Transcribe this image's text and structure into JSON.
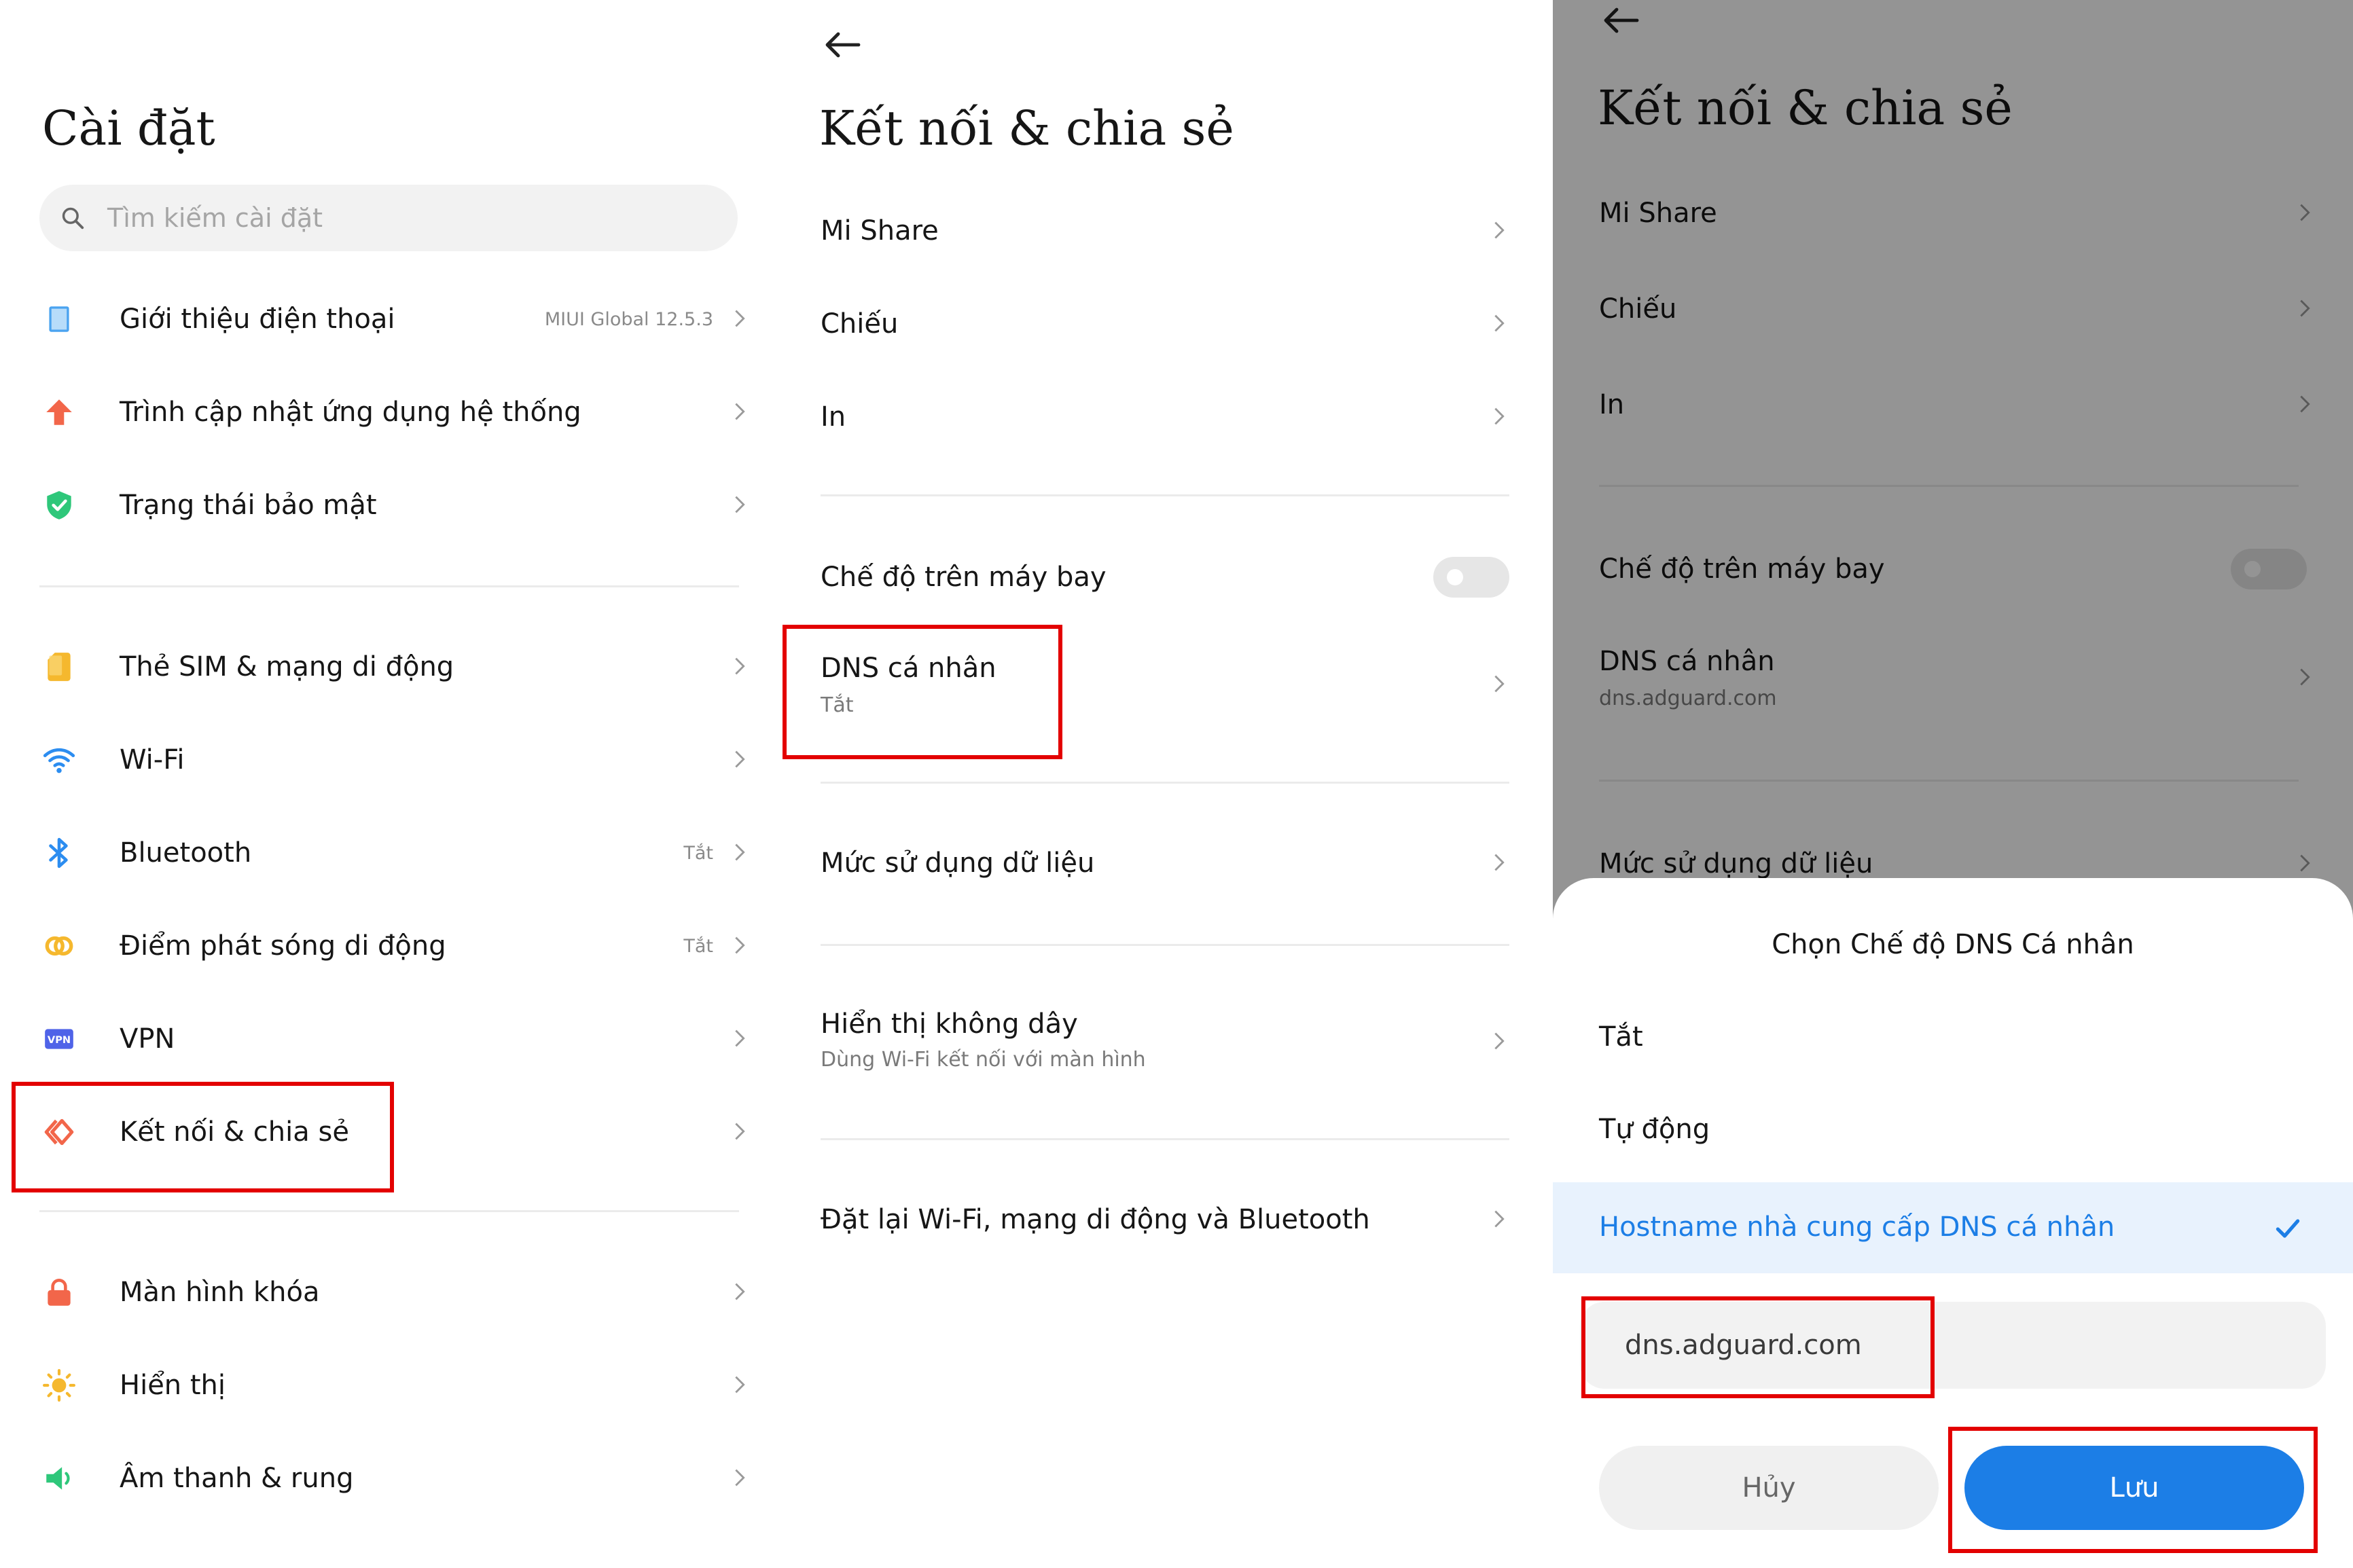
{
  "colors": {
    "accent_blue": "#1c7ee6",
    "highlight_bg": "#e8f2fd",
    "red_outline": "#e30000",
    "dim_overlay": "rgba(0,0,0,0.42)"
  },
  "panel1": {
    "title": "Cài đặt",
    "search_placeholder": "Tìm kiếm cài đặt",
    "group1": [
      {
        "label": "Giới thiệu điện thoại",
        "value": "MIUI Global 12.5.3",
        "icon": "phone-icon",
        "icon_color": "#4aa3f0"
      },
      {
        "label": "Trình cập nhật ứng dụng hệ thống",
        "value": "",
        "icon": "arrow-up-icon",
        "icon_color": "#f2664a"
      },
      {
        "label": "Trạng thái bảo mật",
        "value": "",
        "icon": "shield-icon",
        "icon_color": "#2ec77a"
      }
    ],
    "group2": [
      {
        "label": "Thẻ SIM & mạng di động",
        "value": "",
        "icon": "sim-icon",
        "icon_color": "#f5b82e"
      },
      {
        "label": "Wi-Fi",
        "value": "",
        "icon": "wifi-icon",
        "icon_color": "#2c8df0"
      },
      {
        "label": "Bluetooth",
        "value": "Tắt",
        "icon": "bluetooth-icon",
        "icon_color": "#2c8df0"
      },
      {
        "label": "Điểm phát sóng di động",
        "value": "Tắt",
        "icon": "hotspot-icon",
        "icon_color": "#f5b82e"
      },
      {
        "label": "VPN",
        "value": "",
        "icon": "vpn-icon",
        "icon_color": "#4f63e8"
      },
      {
        "label": "Kết nối & chia sẻ",
        "value": "",
        "icon": "connection-share-icon",
        "icon_color": "#f2664a"
      }
    ],
    "group3": [
      {
        "label": "Màn hình khóa",
        "value": "",
        "icon": "lock-icon",
        "icon_color": "#f2664a"
      },
      {
        "label": "Hiển thị",
        "value": "",
        "icon": "sun-icon",
        "icon_color": "#f5b82e"
      },
      {
        "label": "Âm thanh & rung",
        "value": "",
        "icon": "speaker-icon",
        "icon_color": "#2ec77a"
      }
    ],
    "vpn_badge": "VPN"
  },
  "panel2": {
    "title": "Kết nối & chia sẻ",
    "mi_share": "Mi Share",
    "chieu": "Chiếu",
    "in": "In",
    "airplane": "Chế độ trên máy bay",
    "dns_label": "DNS cá nhân",
    "dns_value": "Tắt",
    "data_usage": "Mức sử dụng dữ liệu",
    "wireless_display": "Hiển thị không dây",
    "wireless_display_sub": "Dùng Wi-Fi kết nối với màn hình",
    "reset": "Đặt lại Wi-Fi, mạng di động và Bluetooth"
  },
  "panel3": {
    "title": "Kết nối & chia sẻ",
    "mi_share": "Mi Share",
    "chieu": "Chiếu",
    "in": "In",
    "airplane": "Chế độ trên máy bay",
    "dns_label": "DNS cá nhân",
    "dns_value": "dns.adguard.com",
    "data_usage": "Mức sử dụng dữ liệu",
    "dialog": {
      "title": "Chọn Chế độ DNS Cá nhân",
      "options": [
        "Tắt",
        "Tự động",
        "Hostname nhà cung cấp DNS cá nhân"
      ],
      "selected_index": 2,
      "hostname_value": "dns.adguard.com",
      "cancel_label": "Hủy",
      "save_label": "Lưu"
    }
  }
}
